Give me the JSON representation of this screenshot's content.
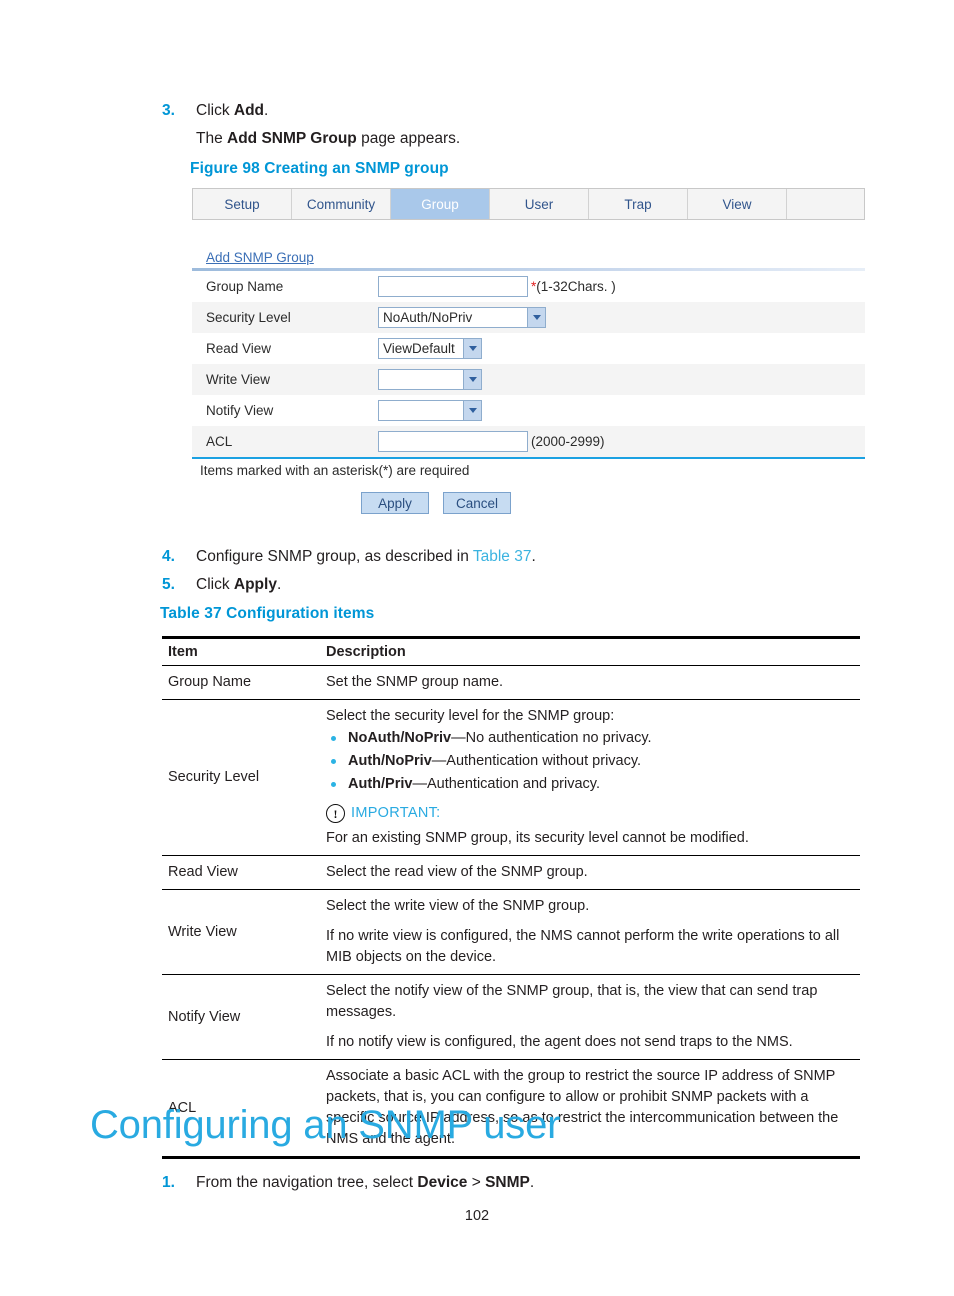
{
  "steps": {
    "step3": {
      "num": "3.",
      "text_before": "Click ",
      "bold": "Add",
      "text_after": "."
    },
    "step3_sub": {
      "text_before": "The ",
      "bold": "Add SNMP Group",
      "text_after": " page appears."
    },
    "step4": {
      "num": "4.",
      "text_before": "Configure SNMP group, as described in ",
      "link": "Table 37",
      "text_after": "."
    },
    "step5": {
      "num": "5.",
      "text_before": "Click ",
      "bold": "Apply",
      "text_after": "."
    },
    "step1": {
      "num": "1.",
      "text_before": "From the navigation tree, select ",
      "bold1": "Device",
      "sep": " > ",
      "bold2": "SNMP",
      "text_after": "."
    }
  },
  "figure_caption": "Figure 98 Creating an SNMP group",
  "table_caption": "Table 37 Configuration items",
  "figure": {
    "tabs": [
      {
        "label": "Setup",
        "selected": false
      },
      {
        "label": "Community",
        "selected": false
      },
      {
        "label": "Group",
        "selected": true
      },
      {
        "label": "User",
        "selected": false
      },
      {
        "label": "Trap",
        "selected": false
      },
      {
        "label": "View",
        "selected": false
      }
    ],
    "panel_title": "Add SNMP Group",
    "fields": [
      {
        "label": "Group Name",
        "control": "text",
        "value": "",
        "hint": "(1-32Chars. )",
        "required": true
      },
      {
        "label": "Security Level",
        "control": "select",
        "value": "NoAuth/NoPriv",
        "hint": "",
        "required": false
      },
      {
        "label": "Read View",
        "control": "select",
        "value": "ViewDefault",
        "hint": "",
        "required": false
      },
      {
        "label": "Write View",
        "control": "select",
        "value": "",
        "hint": "",
        "required": false
      },
      {
        "label": "Notify View",
        "control": "select",
        "value": "",
        "hint": "",
        "required": false
      },
      {
        "label": "ACL",
        "control": "text",
        "value": "",
        "hint": "(2000-2999)",
        "required": false
      }
    ],
    "footnote": "Items marked with an asterisk(*) are required",
    "apply_label": "Apply",
    "cancel_label": "Cancel",
    "required_marker": "*"
  },
  "table": {
    "headers": {
      "item": "Item",
      "description": "Description"
    },
    "rows": {
      "group_name": {
        "item": "Group Name",
        "desc": "Set the SNMP group name."
      },
      "security_level": {
        "item": "Security Level",
        "intro": "Select the security level for the SNMP group:",
        "bullets": [
          {
            "bold": "NoAuth/NoPriv",
            "rest": "—No authentication no privacy."
          },
          {
            "bold": "Auth/NoPriv",
            "rest": "—Authentication without privacy."
          },
          {
            "bold": "Auth/Priv",
            "rest": "—Authentication and privacy."
          }
        ],
        "important_label": "IMPORTANT:",
        "important_text": "For an existing SNMP group, its security level cannot be modified."
      },
      "read_view": {
        "item": "Read View",
        "desc": "Select the read view of the SNMP group."
      },
      "write_view": {
        "item": "Write View",
        "desc1": "Select the write view of the SNMP group.",
        "desc2": "If no write view is configured, the NMS cannot perform the write operations to all MIB objects on the device."
      },
      "notify_view": {
        "item": "Notify View",
        "desc1": "Select the notify view of the SNMP group, that is, the view that can send trap messages.",
        "desc2": "If no notify view is configured, the agent does not send traps to the NMS."
      },
      "acl": {
        "item": "ACL",
        "desc": "Associate a basic ACL with the group to restrict the source IP address of SNMP packets, that is, you can configure to allow or prohibit SNMP packets with a specific source IP address, so as to restrict the intercommunication between the NMS and the agent."
      }
    }
  },
  "heading": "Configuring an SNMP user",
  "page_number": "102",
  "colors": {
    "accent_blue": "#0096d6",
    "link_blue": "#3bb3e0",
    "heading_blue": "#29aae1",
    "tab_selected": "#a9c8ea",
    "required_red": "#e02020"
  }
}
